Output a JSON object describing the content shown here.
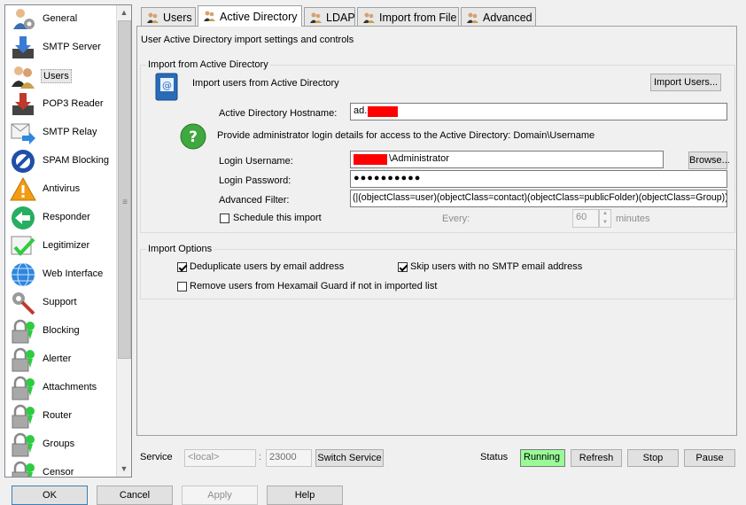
{
  "sidebar": {
    "items": [
      {
        "label": "General",
        "icon": "person-gear-icon"
      },
      {
        "label": "SMTP Server",
        "icon": "download-tray-icon"
      },
      {
        "label": "Users",
        "icon": "users-icon"
      },
      {
        "label": "POP3 Reader",
        "icon": "pop3-tray-icon"
      },
      {
        "label": "SMTP Relay",
        "icon": "relay-arrow-icon"
      },
      {
        "label": "SPAM Blocking",
        "icon": "no-entry-icon"
      },
      {
        "label": "Antivirus",
        "icon": "warning-triangle-icon"
      },
      {
        "label": "Responder",
        "icon": "back-arrow-icon"
      },
      {
        "label": "Legitimizer",
        "icon": "checkmark-icon"
      },
      {
        "label": "Web Interface",
        "icon": "globe-icon"
      },
      {
        "label": "Support",
        "icon": "tools-icon"
      },
      {
        "label": "Blocking",
        "icon": "lock-icon"
      },
      {
        "label": "Alerter",
        "icon": "lock-icon"
      },
      {
        "label": "Attachments",
        "icon": "lock-icon"
      },
      {
        "label": "Router",
        "icon": "lock-icon"
      },
      {
        "label": "Groups",
        "icon": "lock-icon"
      },
      {
        "label": "Censor",
        "icon": "lock-icon"
      }
    ],
    "selected": "Users"
  },
  "tabs": [
    {
      "label": "Users",
      "active": false
    },
    {
      "label": "Active Directory",
      "active": true
    },
    {
      "label": "LDAP",
      "active": false
    },
    {
      "label": "Import from File",
      "active": false
    },
    {
      "label": "Advanced",
      "active": false
    }
  ],
  "panel": {
    "description": "User Active Directory import settings and controls",
    "import_group": {
      "title": "Import from Active Directory",
      "intro": "Import users from Active Directory",
      "import_button": "Import Users...",
      "hostname_label": "Active Directory Hostname:",
      "hostname_value": "ad.",
      "help_text": "Provide administrator login details for access to the Active Directory: Domain\\Username",
      "username_label": "Login Username:",
      "username_value": "\\Administrator",
      "browse_button": "Browse...",
      "password_label": "Login Password:",
      "password_value": "●●●●●●●●●●",
      "filter_label": "Advanced Filter:",
      "filter_value": "(|(objectClass=user)(objectClass=contact)(objectClass=publicFolder)(objectClass=Group))",
      "schedule_label": "Schedule this import",
      "schedule_checked": false,
      "every_label": "Every:",
      "every_value": "60",
      "minutes_label": "minutes"
    },
    "options_group": {
      "title": "Import Options",
      "dedupe_label": "Deduplicate users by email address",
      "dedupe_checked": true,
      "skip_label": "Skip users with no SMTP email address",
      "skip_checked": true,
      "remove_label": "Remove users from Hexamail Guard if not in imported list",
      "remove_checked": false
    }
  },
  "service_bar": {
    "service_label": "Service",
    "host_placeholder": "<local>",
    "colon": ":",
    "port": "23000",
    "switch_button": "Switch Service",
    "status_label": "Status",
    "status_value": "Running",
    "refresh_button": "Refresh",
    "stop_button": "Stop",
    "pause_button": "Pause"
  },
  "dialog_buttons": {
    "ok": "OK",
    "cancel": "Cancel",
    "apply": "Apply",
    "help": "Help"
  },
  "colors": {
    "status_running_bg": "#98fb98",
    "redaction": "#ff0000"
  }
}
